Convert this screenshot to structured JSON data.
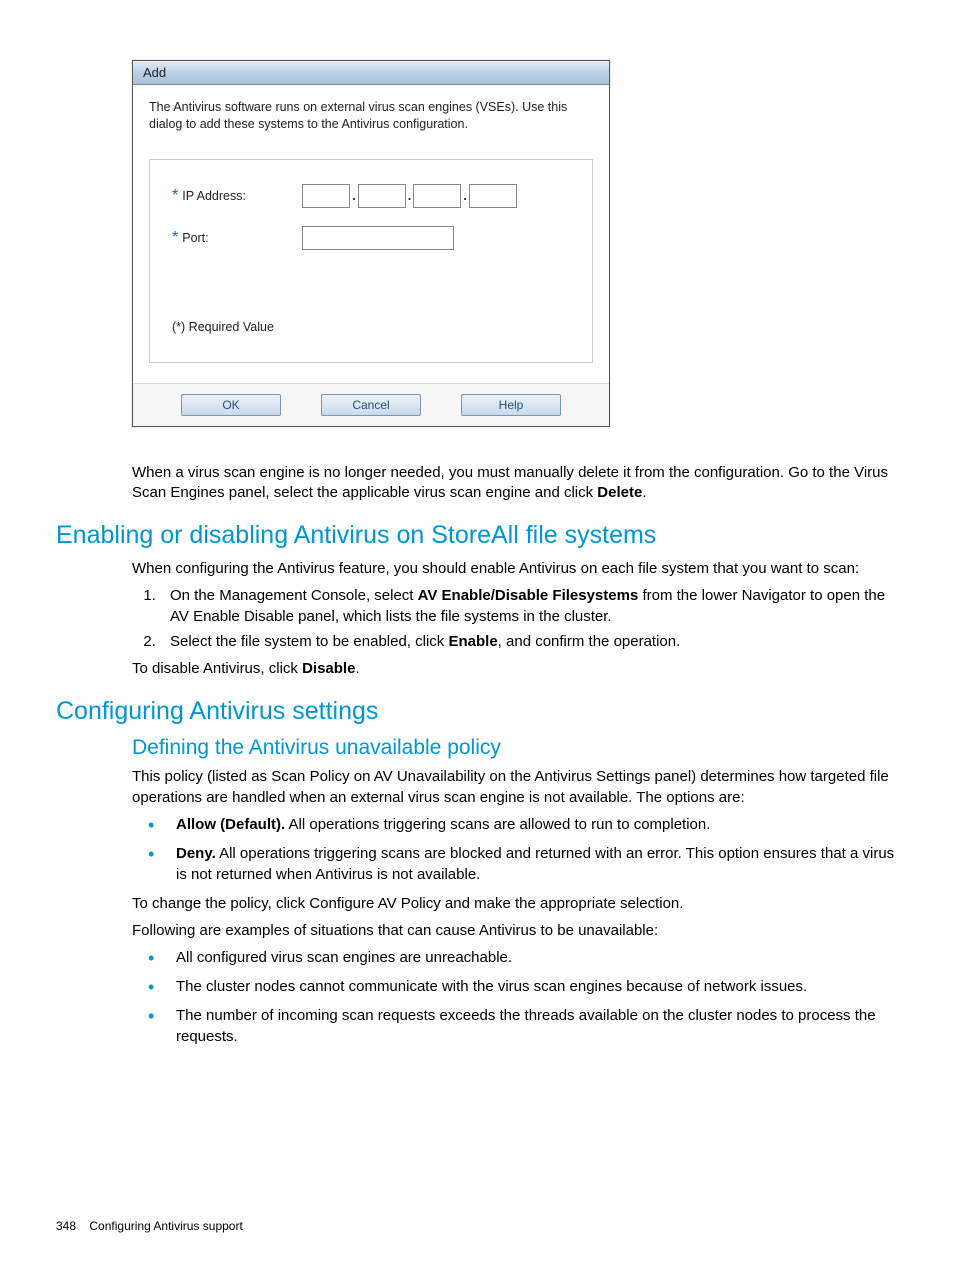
{
  "dialog": {
    "title": "Add",
    "description": "The Antivirus software runs on external virus scan engines (VSEs). Use this dialog to add these systems to the Antivirus configuration.",
    "ip_label": "IP Address:",
    "port_label": "Port:",
    "required_note": "(*) Required Value",
    "ok": "OK",
    "cancel": "Cancel",
    "help": "Help"
  },
  "para_after_dialog_1": "When a virus scan engine is no longer needed, you must manually delete it from the configuration. Go to the Virus Scan Engines panel, select the applicable virus scan engine and click ",
  "para_after_dialog_bold": "Delete",
  "para_after_dialog_2": ".",
  "h2_enable": "Enabling or disabling Antivirus on StoreAll file systems",
  "enable_intro": "When configuring the Antivirus feature, you should enable Antivirus on each file system that you want to scan:",
  "step1_a": "On the Management Console, select ",
  "step1_bold": "AV Enable/Disable Filesystems",
  "step1_b": " from the lower Navigator to open the AV Enable Disable panel, which lists the file systems in the cluster.",
  "step2_a": "Select the file system to be enabled, click ",
  "step2_bold": "Enable",
  "step2_b": ", and confirm the operation.",
  "disable_a": "To disable Antivirus, click ",
  "disable_bold": "Disable",
  "disable_b": ".",
  "h2_config": "Configuring Antivirus settings",
  "h3_policy": "Defining the Antivirus unavailable policy",
  "policy_intro": "This policy (listed as Scan Policy on AV Unavailability on the Antivirus Settings panel) determines how targeted file operations are handled when an external virus scan engine is not available. The options are:",
  "opt1_bold": "Allow (Default).",
  "opt1_text": " All operations triggering scans are allowed to run to completion.",
  "opt2_bold": "Deny.",
  "opt2_text": " All operations triggering scans are blocked and returned with an error. This option ensures that a virus is not returned when Antivirus is not available.",
  "change_policy": "To change the policy, click Configure AV Policy and make the appropriate selection.",
  "examples_intro": "Following are examples of situations that can cause Antivirus to be unavailable:",
  "ex1": "All configured virus scan engines are unreachable.",
  "ex2": "The cluster nodes cannot communicate with the virus scan engines because of network issues.",
  "ex3": "The number of incoming scan requests exceeds the threads available on the cluster nodes to process the requests.",
  "footer_page": "348",
  "footer_text": "Configuring Antivirus support"
}
